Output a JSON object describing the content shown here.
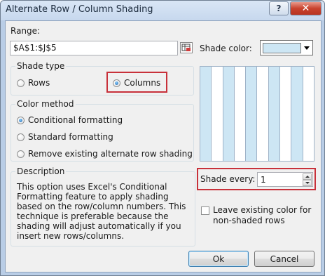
{
  "window": {
    "title": "Alternate Row / Column Shading",
    "help_label": "?",
    "close_label": "✕"
  },
  "range": {
    "label": "Range:",
    "value": "$A$1:$J$5"
  },
  "shade_color": {
    "label": "Shade color:",
    "swatch_color": "#cde6f4"
  },
  "shade_type": {
    "title": "Shade type",
    "options": [
      "Rows",
      "Columns"
    ],
    "selected": "Columns"
  },
  "color_method": {
    "title": "Color method",
    "options": [
      "Conditional formatting",
      "Standard formatting",
      "Remove existing alternate row shading"
    ],
    "selected": "Conditional formatting"
  },
  "description": {
    "title": "Description",
    "text": "This option uses Excel's Conditional Formatting feature to apply shading based on the row/column numbers. This technique is preferable because the shading will adjust automatically if you insert new rows/columns."
  },
  "shade_every": {
    "label": "Shade every:",
    "value": "1"
  },
  "leave_existing": {
    "label": "Leave existing color for non-shaded rows",
    "checked": false
  },
  "buttons": {
    "ok": "Ok",
    "cancel": "Cancel"
  },
  "colors": {
    "highlight_border": "#c8313a",
    "shaded_column": "#cde6f4"
  }
}
